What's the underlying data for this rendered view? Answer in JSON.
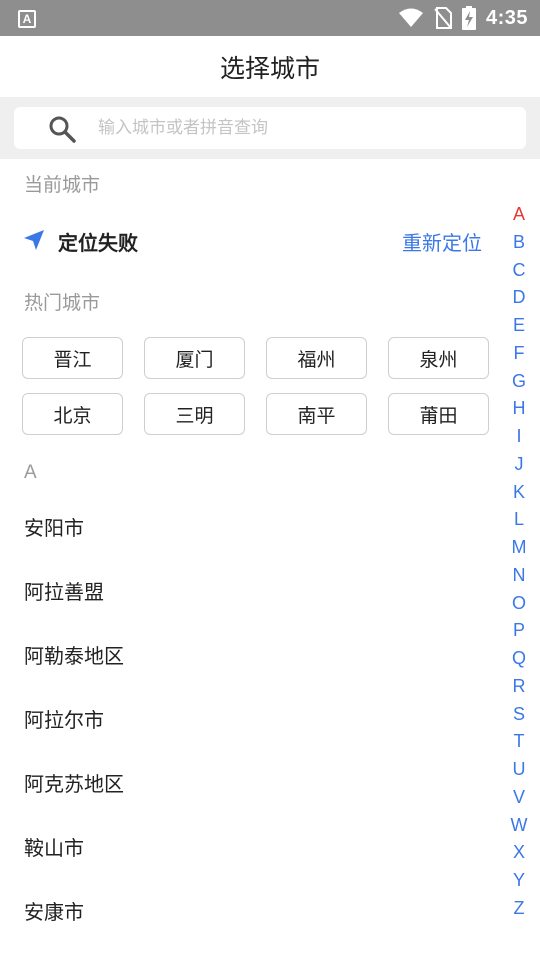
{
  "status_bar": {
    "left_icon_text": "A",
    "time": "4:35"
  },
  "header": {
    "title": "选择城市"
  },
  "search": {
    "placeholder": "输入城市或者拼音查询"
  },
  "current_city": {
    "section_label": "当前城市",
    "status": "定位失败",
    "relocate_label": "重新定位"
  },
  "hot_cities": {
    "section_label": "热门城市",
    "items": [
      "晋江",
      "厦门",
      "福州",
      "泉州",
      "北京",
      "三明",
      "南平",
      "莆田"
    ]
  },
  "city_list": {
    "letter": "A",
    "items": [
      "安阳市",
      "阿拉善盟",
      "阿勒泰地区",
      "阿拉尔市",
      "阿克苏地区",
      "鞍山市",
      "安康市"
    ]
  },
  "index_bar": {
    "active": "A",
    "active_color": "#e53935",
    "color": "#3b78e7",
    "letters": [
      "A",
      "B",
      "C",
      "D",
      "E",
      "F",
      "G",
      "H",
      "I",
      "J",
      "K",
      "L",
      "M",
      "N",
      "O",
      "P",
      "Q",
      "R",
      "S",
      "T",
      "U",
      "V",
      "W",
      "X",
      "Y",
      "Z"
    ]
  },
  "colors": {
    "accent": "#3b78e7",
    "status_bar": "#8e8e8e"
  }
}
